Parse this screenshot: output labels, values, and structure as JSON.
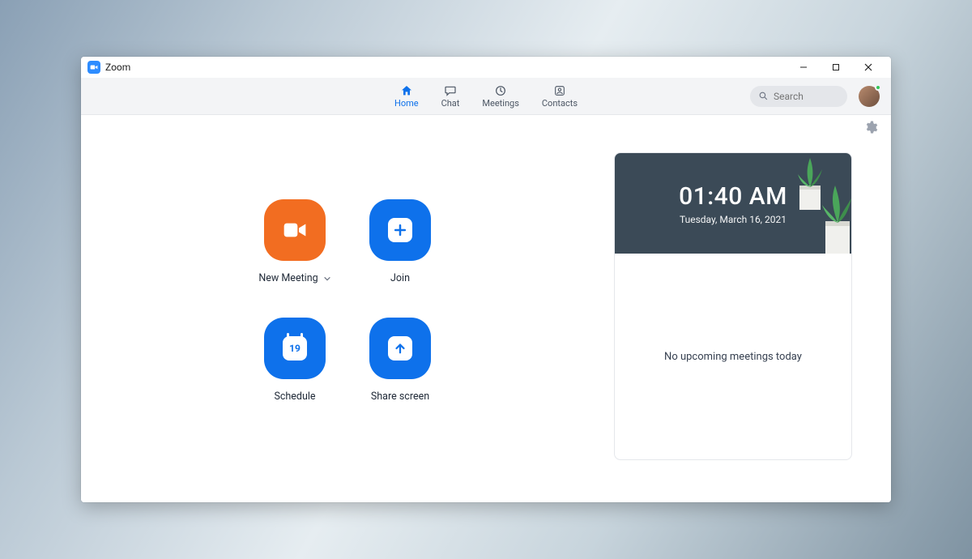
{
  "app": {
    "title": "Zoom"
  },
  "tabs": {
    "home": {
      "label": "Home",
      "active": true
    },
    "chat": {
      "label": "Chat",
      "active": false
    },
    "meetings": {
      "label": "Meetings",
      "active": false
    },
    "contacts": {
      "label": "Contacts",
      "active": false
    }
  },
  "search": {
    "placeholder": "Search"
  },
  "actions": {
    "new_meeting": {
      "label": "New Meeting"
    },
    "join": {
      "label": "Join"
    },
    "schedule": {
      "label": "Schedule",
      "day": "19"
    },
    "share_screen": {
      "label": "Share screen"
    }
  },
  "card": {
    "time": "01:40 AM",
    "date": "Tuesday, March 16, 2021",
    "empty_message": "No upcoming meetings today"
  },
  "colors": {
    "brand_blue": "#0E71EB",
    "accent_orange": "#F26D21",
    "presence_green": "#34c759"
  }
}
